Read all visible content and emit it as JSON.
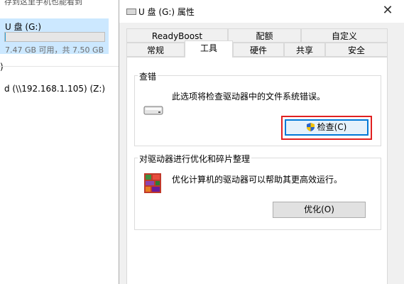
{
  "background": {
    "top_text": "存到这里手机也能看到",
    "drive": {
      "name": "U 盘 (G:)",
      "info": "7.47 GB 可用，共 7.50 GB",
      "free_gb": 7.47,
      "total_gb": 7.5
    },
    "paren": ")",
    "network_drive": "d (\\\\192.168.1.105) (Z:)"
  },
  "dialog": {
    "title": "U 盘 (G:) 属性",
    "close_glyph": "✕",
    "tabs_row1": [
      "ReadyBoost",
      "配额",
      "自定义"
    ],
    "tabs_row2": [
      "常规",
      "工具",
      "硬件",
      "共享",
      "安全"
    ],
    "active_tab": "工具",
    "check_group": {
      "label": "查错",
      "description": "此选项将检查驱动器中的文件系统错误。",
      "button": "检查(C)"
    },
    "optimize_group": {
      "label": "对驱动器进行优化和碎片整理",
      "description": "优化计算机的驱动器可以帮助其更高效运行。",
      "button": "优化(O)"
    }
  },
  "colors": {
    "accent": "#0078d7",
    "highlight_border": "#e02020",
    "selection": "#cce8ff"
  }
}
